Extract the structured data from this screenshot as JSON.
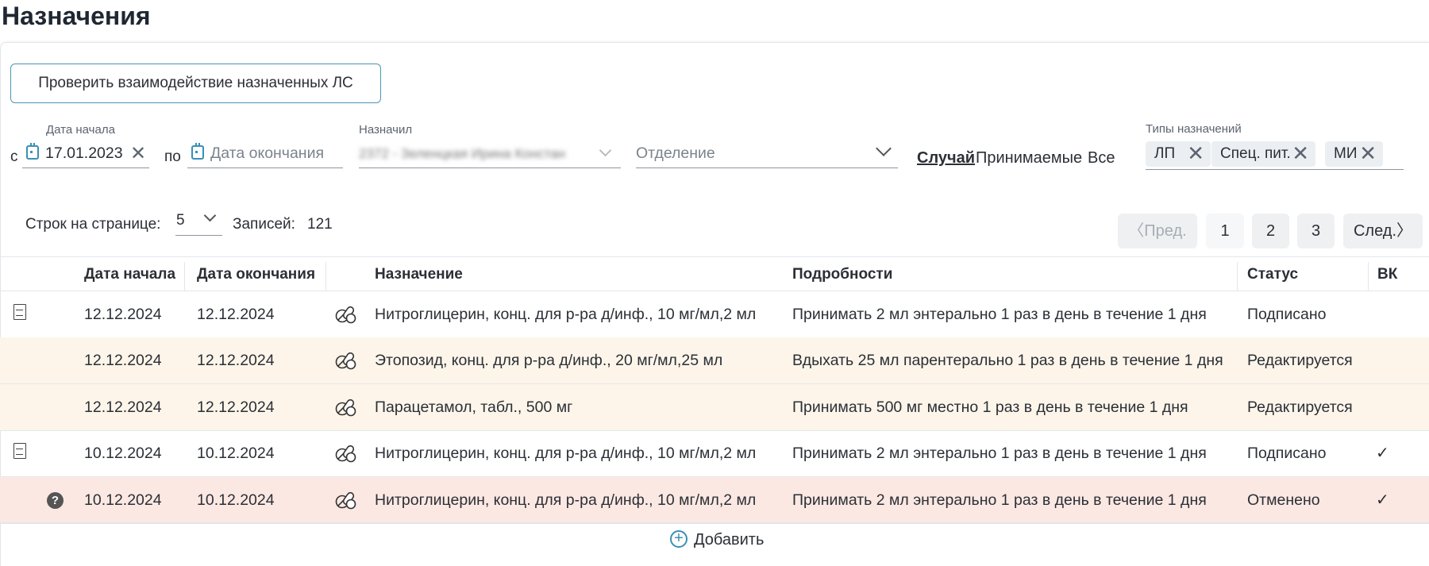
{
  "page": {
    "title": "Назначения"
  },
  "toolbar": {
    "check_interactions": "Проверить взаимодействие назначенных ЛС"
  },
  "filters": {
    "from_prefix": "с",
    "start_date_label": "Дата начала",
    "start_date_value": "17.01.2023",
    "to_prefix": "по",
    "end_date_placeholder": "Дата окончания",
    "prescriber_label": "Назначил",
    "prescriber_value": "2372 - Зеленцкая Ирина Констан",
    "department_placeholder": "Отделение",
    "case_link": "Случай",
    "accepted": "Принимаемые",
    "all": "Все",
    "types_label": "Типы назначений",
    "types": [
      "ЛП",
      "Спец. пит.",
      "МИ"
    ]
  },
  "pagination": {
    "rows_label": "Строк на странице:",
    "rows_value": "5",
    "records_label": "Записей:",
    "records_value": "121",
    "prev": "Пред.",
    "pages": [
      "1",
      "2",
      "3"
    ],
    "next": "След."
  },
  "table": {
    "headers": {
      "start": "Дата начала",
      "end": "Дата окончания",
      "prescription": "Назначение",
      "details": "Подробности",
      "status": "Статус",
      "vk": "ВК"
    },
    "rows": [
      {
        "start": "12.12.2024",
        "end": "12.12.2024",
        "prescription": "Нитроглицерин, конц. для р-ра д/инф., 10 мг/мл,2 мл",
        "details": "Принимать 2 мл энтерально 1 раз в день в течение 1 дня",
        "status": "Подписано",
        "state": "signed",
        "doc_icon": true,
        "vk": false
      },
      {
        "start": "12.12.2024",
        "end": "12.12.2024",
        "prescription": "Этопозид, конц. для р-ра д/инф., 20 мг/мл,25 мл",
        "details": "Вдыхать 25 мл парентерально 1 раз в день в течение 1 дня",
        "status": "Редактируется",
        "state": "edit",
        "doc_icon": false,
        "vk": false
      },
      {
        "start": "12.12.2024",
        "end": "12.12.2024",
        "prescription": "Парацетамол, табл., 500 мг",
        "details": "Принимать 500 мг местно 1 раз в день в течение 1 дня",
        "status": "Редактируется",
        "state": "edit",
        "doc_icon": false,
        "vk": false
      },
      {
        "start": "10.12.2024",
        "end": "10.12.2024",
        "prescription": "Нитроглицерин, конц. для р-ра д/инф., 10 мг/мл,2 мл",
        "details": "Принимать 2 мл энтерально 1 раз в день в течение 1 дня",
        "status": "Подписано",
        "state": "signed",
        "doc_icon": true,
        "vk": true
      },
      {
        "start": "10.12.2024",
        "end": "10.12.2024",
        "prescription": "Нитроглицерин, конц. для р-ра д/инф., 10 мг/мл,2 мл",
        "details": "Принимать 2 мл энтерально 1 раз в день в течение 1 дня",
        "status": "Отменено",
        "state": "canceled",
        "doc_icon": false,
        "help_icon": true,
        "vk": true
      }
    ]
  },
  "add_label": "Добавить"
}
